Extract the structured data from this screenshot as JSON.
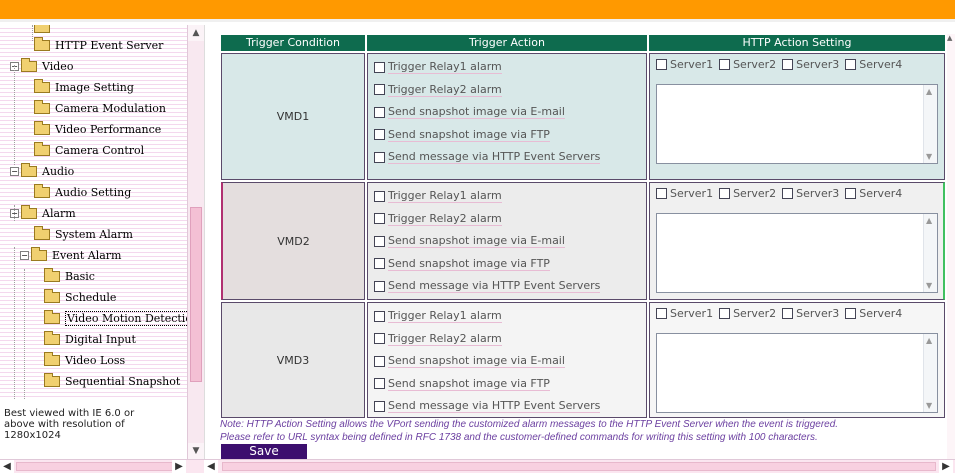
{
  "tree": {
    "top_partial": "",
    "items": [
      {
        "label": "HTTP Event Server",
        "toggle": ""
      },
      {
        "label": "Video",
        "toggle": "−"
      },
      {
        "label": "Image Setting",
        "toggle": ""
      },
      {
        "label": "Camera Modulation",
        "toggle": ""
      },
      {
        "label": "Video Performance",
        "toggle": ""
      },
      {
        "label": "Camera Control",
        "toggle": ""
      },
      {
        "label": "Audio",
        "toggle": "−"
      },
      {
        "label": "Audio Setting",
        "toggle": ""
      },
      {
        "label": "Alarm",
        "toggle": "−"
      },
      {
        "label": "System Alarm",
        "toggle": ""
      },
      {
        "label": "Event Alarm",
        "toggle": "−"
      },
      {
        "label": "Basic",
        "toggle": ""
      },
      {
        "label": "Schedule",
        "toggle": ""
      },
      {
        "label": "Video Motion Detection",
        "toggle": ""
      },
      {
        "label": "Digital Input",
        "toggle": ""
      },
      {
        "label": "Video Loss",
        "toggle": ""
      },
      {
        "label": "Sequential Snapshot",
        "toggle": ""
      }
    ],
    "selected": "Video Motion Detection"
  },
  "best_viewed": [
    "Best viewed with IE 6.0 or",
    "above with resolution of",
    "1280x1024"
  ],
  "table": {
    "headers": [
      "Trigger Condition",
      "Trigger Action",
      "HTTP Action Setting"
    ],
    "actions": [
      "Trigger Relay1 alarm",
      "Trigger Relay2 alarm",
      "Send snapshot image via E-mail",
      "Send snapshot image via FTP",
      "Send message via HTTP Event Servers"
    ],
    "servers": [
      "Server1",
      "Server2",
      "Server3",
      "Server4"
    ],
    "rows": [
      {
        "condition": "VMD1"
      },
      {
        "condition": "VMD2"
      },
      {
        "condition": "VMD3"
      }
    ]
  },
  "note": [
    "Note: HTTP Action Setting allows the VPort sending the customized alarm messages to the HTTP Event Server when the event is triggered.",
    "Please refer to URL syntax being defined in RFC 1738 and the customer-defined commands for writing this setting with 100 characters."
  ],
  "save_label": "Save",
  "icons": {
    "scroll_up": "▲",
    "scroll_down": "▼",
    "scroll_left": "◀",
    "scroll_right": "▶",
    "collapse": "−"
  },
  "colors": {
    "top_bar": "#ff9900",
    "table_header": "#0e6b4e",
    "note_text": "#6b3fa0",
    "save_button": "#3c0f6e"
  }
}
